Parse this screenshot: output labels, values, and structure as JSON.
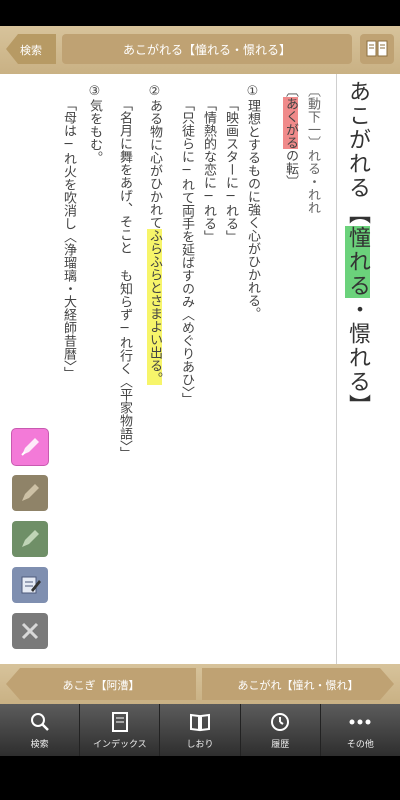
{
  "header": {
    "back_label": "検索",
    "title": "あこがれる【憧れる・憬れる】",
    "book_icon": "book-icon"
  },
  "entry": {
    "headword": "あこがれる",
    "kanji_highlight": "憧れる",
    "kanji_rest": "・憬れる",
    "conjugation": "〔動下一〕",
    "grammar_note": "れる・れれ",
    "origin_highlight": "あくがる",
    "origin_tail": "の転",
    "sense1": "①理想とするものに強く心がひかれる。",
    "ex1a": "「映画スターに─れる」",
    "ex1b": "「情熱的な恋に─れる」",
    "ex1c": "「只徒らに─れて両手を延ばすのみ〈めぐりあひ〉」",
    "sense2_a": "②ある物に心がひかれて",
    "sense2_highlight": "ふらふらとさまよい出る。",
    "ex2": "「名月に舞をあげ、そこと も知らず─れ行く〈平家物語〉」",
    "sense3": "③気をもむ。",
    "ex3": "「母は─れ火を吹消し〈浄瑠璃・大経師昔暦〉」"
  },
  "tools": [
    {
      "name": "pink-highlighter-icon",
      "color": "#f37ad8"
    },
    {
      "name": "brown-highlighter-icon",
      "color": "#8f8368"
    },
    {
      "name": "green-highlighter-icon",
      "color": "#6f8f67"
    },
    {
      "name": "memo-icon",
      "color": "#7f8fb0"
    },
    {
      "name": "eraser-icon",
      "color": "#7a7a7a"
    }
  ],
  "nav": {
    "prev_label": "あこぎ【阿漕】",
    "next_label": "あこがれ【憧れ・憬れ】"
  },
  "tabs": [
    {
      "label": "検索",
      "icon": "search-icon"
    },
    {
      "label": "インデックス",
      "icon": "index-icon"
    },
    {
      "label": "しおり",
      "icon": "bookmark-icon"
    },
    {
      "label": "履歴",
      "icon": "history-icon"
    },
    {
      "label": "その他",
      "icon": "more-icon"
    }
  ]
}
